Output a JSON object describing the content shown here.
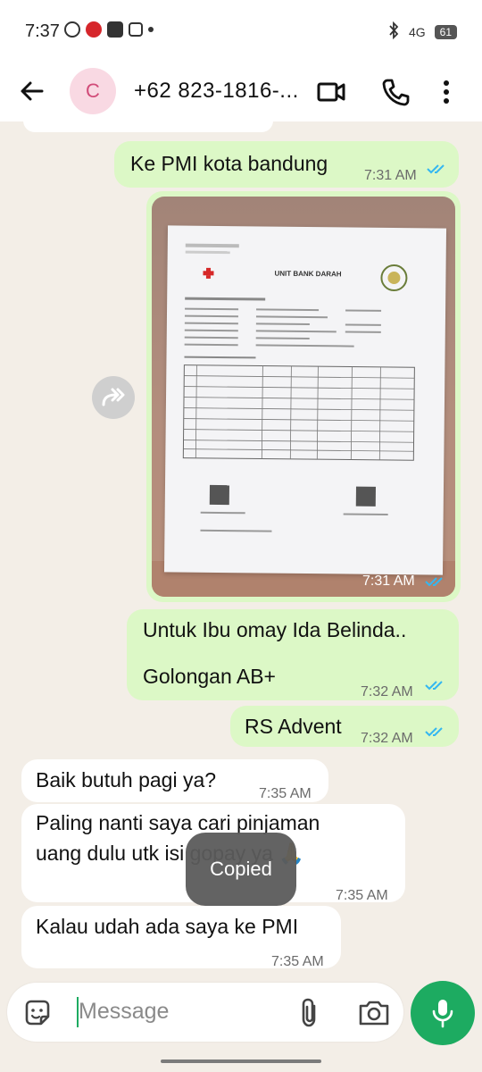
{
  "status_bar": {
    "time": "7:37",
    "network": "4G",
    "battery": "61"
  },
  "header": {
    "avatar_letter": "C",
    "contact_name": "+62 823-1816-..."
  },
  "messages": [
    {
      "dir": "out",
      "text": "Ke PMI kota bandung",
      "time": "7:31 AM"
    },
    {
      "dir": "out",
      "image": true,
      "time": "7:31 AM",
      "doc_title": "UNIT BANK DARAH"
    },
    {
      "dir": "out",
      "line1": "Untuk Ibu omay Ida Belinda..",
      "line2": "Golongan AB+",
      "time": "7:32 AM"
    },
    {
      "dir": "out",
      "text": "RS Advent",
      "time": "7:32 AM"
    },
    {
      "dir": "in",
      "text": "Baik butuh pagi ya?",
      "time": "7:35 AM"
    },
    {
      "dir": "in",
      "line1": "Paling nanti saya cari pinjaman",
      "line2": "uang dulu utk isi gopay ya 🙏",
      "time": "7:35 AM"
    },
    {
      "dir": "in",
      "text": "Kalau udah ada saya ke PMI",
      "time": "7:35 AM"
    }
  ],
  "toast": "Copied",
  "composer": {
    "placeholder": "Message"
  },
  "colors": {
    "outgoing_bubble": "#dcf8c6",
    "incoming_bubble": "#ffffff",
    "chat_background": "#f3eee7",
    "accent": "#1dab61",
    "read_tick": "#34b7f1"
  }
}
